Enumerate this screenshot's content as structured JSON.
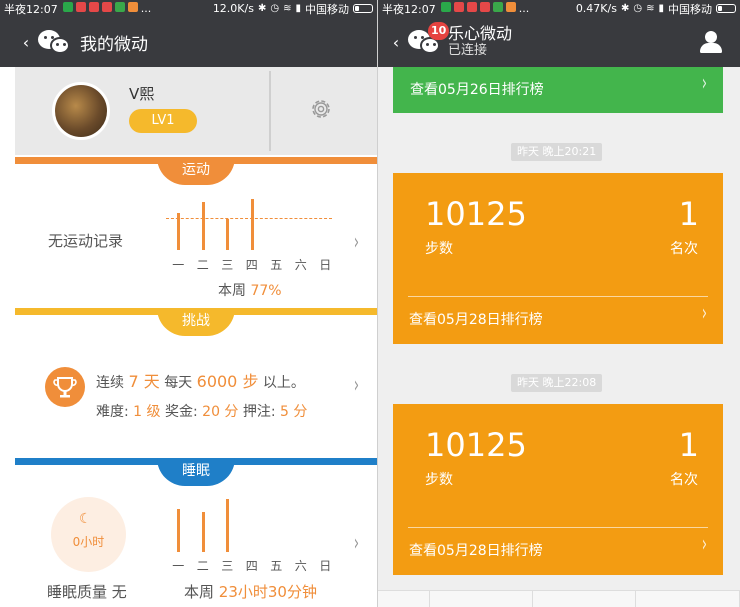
{
  "left": {
    "status": {
      "time": "半夜12:07",
      "speed": "12.0K/s",
      "carrier": "中国移动",
      "dots": "..."
    },
    "nav": {
      "back": "‹",
      "title": "我的微动"
    },
    "profile": {
      "name": "V熙",
      "level": "LV1"
    },
    "exercise": {
      "tab": "运动",
      "no_record": "无运动记录",
      "days": [
        "一",
        "二",
        "三",
        "四",
        "五",
        "六",
        "日"
      ],
      "bar_values": [
        0.55,
        0.7,
        0.45,
        0.75,
        0,
        0,
        0
      ],
      "week_label": "本周",
      "week_pct": "77%"
    },
    "challenge": {
      "tab": "挑战",
      "line1_a": "连续",
      "line1_days": "7 天",
      "line1_b": "每天",
      "line1_steps": "6000 步",
      "line1_c": "以上。",
      "line2_a": "难度:",
      "line2_level": "1 级",
      "line2_b": "奖金:",
      "line2_bonus": "20 分",
      "line2_c": "押注:",
      "line2_bet": "5 分"
    },
    "sleep": {
      "tab": "睡眠",
      "hours": "0小时",
      "quality_label": "睡眠质量 无",
      "days": [
        "一",
        "二",
        "三",
        "四",
        "五",
        "六",
        "日"
      ],
      "bar_values": [
        0.7,
        0.65,
        0.85,
        0,
        0,
        0,
        0
      ],
      "week_label": "本周",
      "week_total": "23小时30分钟"
    }
  },
  "right": {
    "status": {
      "time": "半夜12:07",
      "speed": "0.47K/s",
      "carrier": "中国移动",
      "dots": "..."
    },
    "nav": {
      "back": "‹",
      "badge": "10",
      "title": "乐心微动",
      "subtitle": "已连接"
    },
    "top_link": "查看05月26日排行榜",
    "cards": [
      {
        "time": "昨天 晚上20:21",
        "steps": "10125",
        "steps_label": "步数",
        "rank": "1",
        "rank_label": "名次",
        "link": "查看05月28日排行榜"
      },
      {
        "time": "昨天 晚上22:08",
        "steps": "10125",
        "steps_label": "步数",
        "rank": "1",
        "rank_label": "名次",
        "link": "查看05月28日排行榜"
      }
    ]
  },
  "colors": {
    "orange": "#f08e3a",
    "accent_yellow": "#f5b92c",
    "green": "#43b54c",
    "card_orange": "#f39c12",
    "sleep_blue": "#1f7fc8",
    "nav_dark": "#393a3e"
  }
}
